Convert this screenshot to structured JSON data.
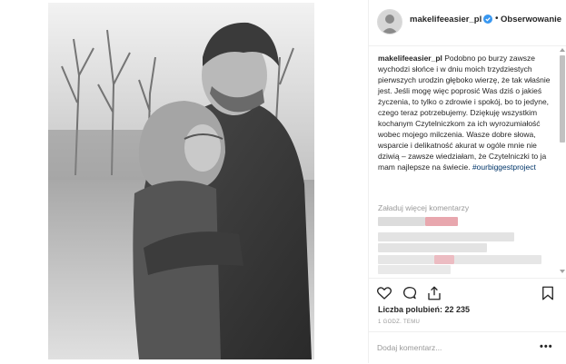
{
  "post": {
    "image_alt": "",
    "colors": {
      "link": "#003569",
      "muted": "#999999",
      "verified": "#3897f0",
      "blur_pink": "#e8a7ae",
      "blur_gray": "#d9d9d9"
    }
  },
  "header": {
    "username": "makelifeeasier_pl",
    "separator": "•",
    "follow_label": "Obserwowanie"
  },
  "caption": {
    "username": "makelifeeasier_pl",
    "text": "Podobno po burzy zawsze wychodzi słońce i w dniu moich trzydziestych pierwszych urodzin głęboko wierzę, że tak właśnie jest. Jeśli mogę więc poprosić Was dziś o jakieś życzenia, to tylko o zdrowie i spokój, bo to jedyne, czego teraz potrzebujemy. Dziękuję wszystkim kochanym Czytelniczkom za ich wyrozumiałość wobec mojego milczenia. Wasze dobre słowa, wsparcie i delikatność akurat w ogóle mnie nie dziwią – zawsze wiedziałam, że Czytelniczki to ja mam najlepsze na świecie.",
    "hashtag": "#ourbiggestproject"
  },
  "comments": {
    "load_more_label": "Załaduj więcej komentarzy"
  },
  "actions": {
    "icons": [
      "heart-icon",
      "comment-icon",
      "share-icon",
      "bookmark-icon"
    ]
  },
  "likes": {
    "label": "Liczba polubień: 22 235"
  },
  "timestamp": {
    "label": "1 GODZ. TEMU"
  },
  "comment_box": {
    "placeholder": "Dodaj komentarz...",
    "value": "",
    "more_label": "•••"
  }
}
